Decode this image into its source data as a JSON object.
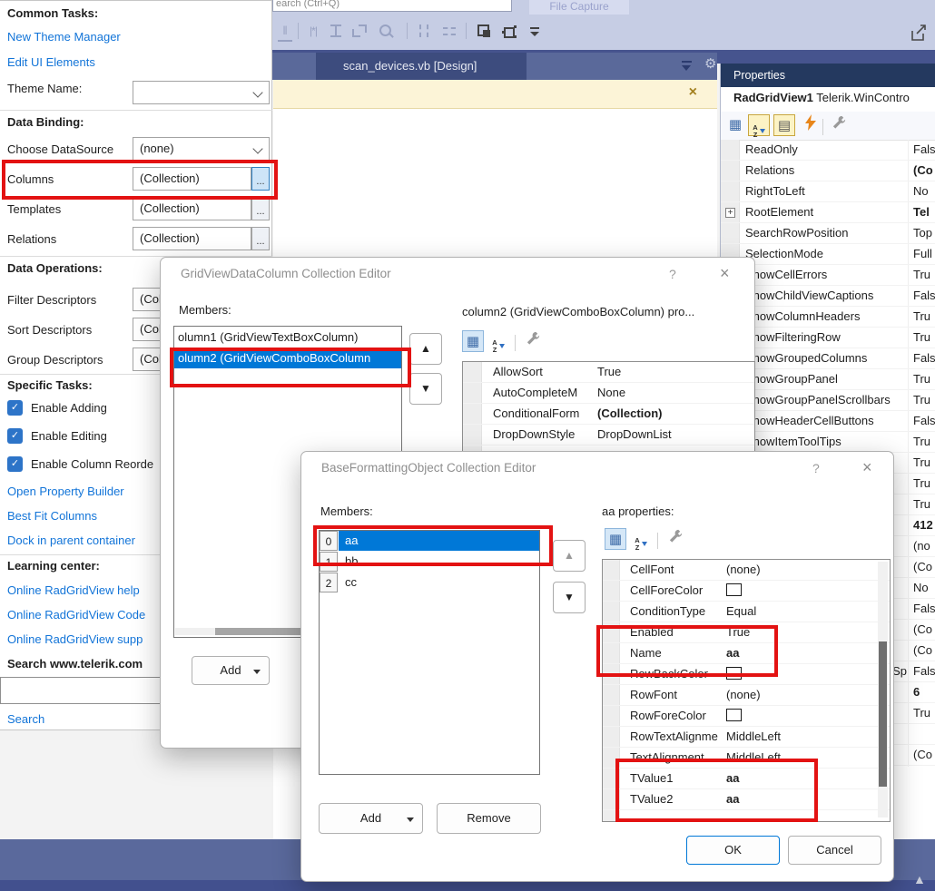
{
  "icons": {
    "close": "×",
    "help": "?",
    "up_arrow": "▲",
    "down_arrow": "▼",
    "check": "✓",
    "gear": "⚙",
    "categorized": "▦",
    "property_pages": "▤",
    "az_a": "A",
    "az_z": "Z",
    "scroll_up": "▲",
    "star_spacing": "|*|",
    "columns_align": "‖",
    "ellipsis": "..."
  },
  "top": {
    "search_text": "earch (Ctrl+Q)",
    "file_capture_label": "File Capture",
    "tab_title": "scan_devices.vb [Design]"
  },
  "left_panel": {
    "common_tasks_title": "Common Tasks:",
    "link_new_theme_manager": "New Theme Manager",
    "link_edit_ui_elements": "Edit UI Elements",
    "theme_name_label": "Theme Name:",
    "theme_name_value": "",
    "data_binding_title": "Data Binding:",
    "choose_datasource_label": "Choose DataSource",
    "choose_datasource_value": "(none)",
    "columns_label": "Columns",
    "columns_value": "(Collection)",
    "templates_label": "Templates",
    "templates_value": "(Collection)",
    "relations_label": "Relations",
    "relations_value": "(Collection)",
    "data_operations_title": "Data Operations:",
    "filter_descriptors_label": "Filter Descriptors",
    "filter_descriptors_value": "(Collection)",
    "sort_descriptors_label": "Sort Descriptors",
    "sort_descriptors_value": "(Collection)",
    "group_descriptors_label": "Group Descriptors",
    "group_descriptors_value": "(Collection)",
    "specific_tasks_title": "Specific Tasks:",
    "check_enable_adding": "Enable Adding",
    "check_enable_editing": "Enable Editing",
    "check_enable_column_reorder": "Enable Column Reorde",
    "link_open_property_builder": "Open Property Builder",
    "link_best_fit_columns": "Best Fit Columns",
    "link_dock_in_parent": "Dock in parent container",
    "learning_center_title": "Learning center:",
    "link_help": "Online RadGridView help",
    "link_code": "Online RadGridView Code",
    "link_support": "Online RadGridView supp",
    "search_telerik_title": "Search www.telerik.com",
    "search_value": "",
    "link_search": "Search"
  },
  "properties_panel": {
    "title": "Properties",
    "object_name": "RadGridView1",
    "object_type": "Telerik.WinContro",
    "rows": [
      {
        "name": "ReadOnly",
        "value": "Fals"
      },
      {
        "name": "Relations",
        "value": "(Co",
        "bold": true
      },
      {
        "name": "RightToLeft",
        "value": "No"
      },
      {
        "name": "RootElement",
        "value": "Tel",
        "bold": true,
        "expander": true
      },
      {
        "name": "SearchRowPosition",
        "value": "Top"
      },
      {
        "name": "SelectionMode",
        "value": "Full"
      },
      {
        "name": "ShowCellErrors",
        "value": "Tru"
      },
      {
        "name": "ShowChildViewCaptions",
        "value": "Fals"
      },
      {
        "name": "ShowColumnHeaders",
        "value": "Tru"
      },
      {
        "name": "ShowFilteringRow",
        "value": "Tru"
      },
      {
        "name": "ShowGroupedColumns",
        "value": "Fals"
      },
      {
        "name": "ShowGroupPanel",
        "value": "Tru"
      },
      {
        "name": "ShowGroupPanelScrollbars",
        "value": "Tru"
      },
      {
        "name": "ShowHeaderCellButtons",
        "value": "Fals"
      },
      {
        "name": "ShowItemToolTips",
        "value": "Tru"
      },
      {
        "name": "",
        "value": "Tru"
      },
      {
        "name": "",
        "value": "Tru"
      },
      {
        "name": "",
        "value": "Tru"
      },
      {
        "name": "",
        "value": "412",
        "bold": true
      },
      {
        "name": "",
        "value": "(no"
      },
      {
        "name": "",
        "value": "(Co"
      },
      {
        "name": "",
        "value": "No"
      },
      {
        "name": "",
        "value": "Fals"
      },
      {
        "name": "",
        "value": "(Co"
      },
      {
        "name": "",
        "value": "(Co"
      },
      {
        "name": "Sp",
        "value": "Fals",
        "tail": true
      },
      {
        "name": "",
        "value": "6",
        "bold": true
      },
      {
        "name": "",
        "value": "Tru"
      },
      {
        "name": "",
        "value": ""
      },
      {
        "name": "",
        "value": "(Co"
      }
    ]
  },
  "dialog1": {
    "title": "GridViewDataColumn Collection Editor",
    "members_label": "Members:",
    "items": [
      {
        "text": "olumn1 (GridViewTextBoxColumn)"
      },
      {
        "text": "olumn2 (GridViewComboBoxColumn",
        "selected": true
      }
    ],
    "props_label": "column2 (GridViewComboBoxColumn) pro...",
    "rows": [
      {
        "name": "AllowSort",
        "value": "True"
      },
      {
        "name": "AutoCompleteM",
        "value": "None"
      },
      {
        "name": "ConditionalForm",
        "value": "(Collection)",
        "bold": true
      },
      {
        "name": "DropDownStyle",
        "value": "DropDownList"
      }
    ],
    "add_label": "Add"
  },
  "dialog2": {
    "title": "BaseFormattingObject Collection Editor",
    "members_label": "Members:",
    "items": [
      {
        "index": "0",
        "text": "aa",
        "selected": true
      },
      {
        "index": "1",
        "text": "bb"
      },
      {
        "index": "2",
        "text": "cc"
      }
    ],
    "props_label": "aa properties:",
    "rows": [
      {
        "name": "CellFont",
        "value": "(none)"
      },
      {
        "name": "CellForeColor",
        "value": "",
        "swatch": true
      },
      {
        "name": "ConditionType",
        "value": "Equal"
      },
      {
        "name": "Enabled",
        "value": "True"
      },
      {
        "name": "Name",
        "value": "aa",
        "bold": true
      },
      {
        "name": "RowBackColor",
        "value": "",
        "swatch": true
      },
      {
        "name": "RowFont",
        "value": "(none)"
      },
      {
        "name": "RowForeColor",
        "value": "",
        "swatch": true
      },
      {
        "name": "RowTextAlignme",
        "value": "MiddleLeft"
      },
      {
        "name": "TextAlignment",
        "value": "MiddleLeft"
      },
      {
        "name": "TValue1",
        "value": "aa",
        "bold": true
      },
      {
        "name": "TValue2",
        "value": "aa",
        "bold": true
      }
    ],
    "add_label": "Add",
    "remove_label": "Remove",
    "ok_label": "OK",
    "cancel_label": "Cancel"
  },
  "colors": {
    "accent_blue": "#0078d7",
    "annotation_red": "#e31212",
    "link_blue": "#1274d8",
    "properties_header": "#24395f",
    "tab_strip": "#5a699a",
    "notification_yellow": "#fcf4d7"
  }
}
